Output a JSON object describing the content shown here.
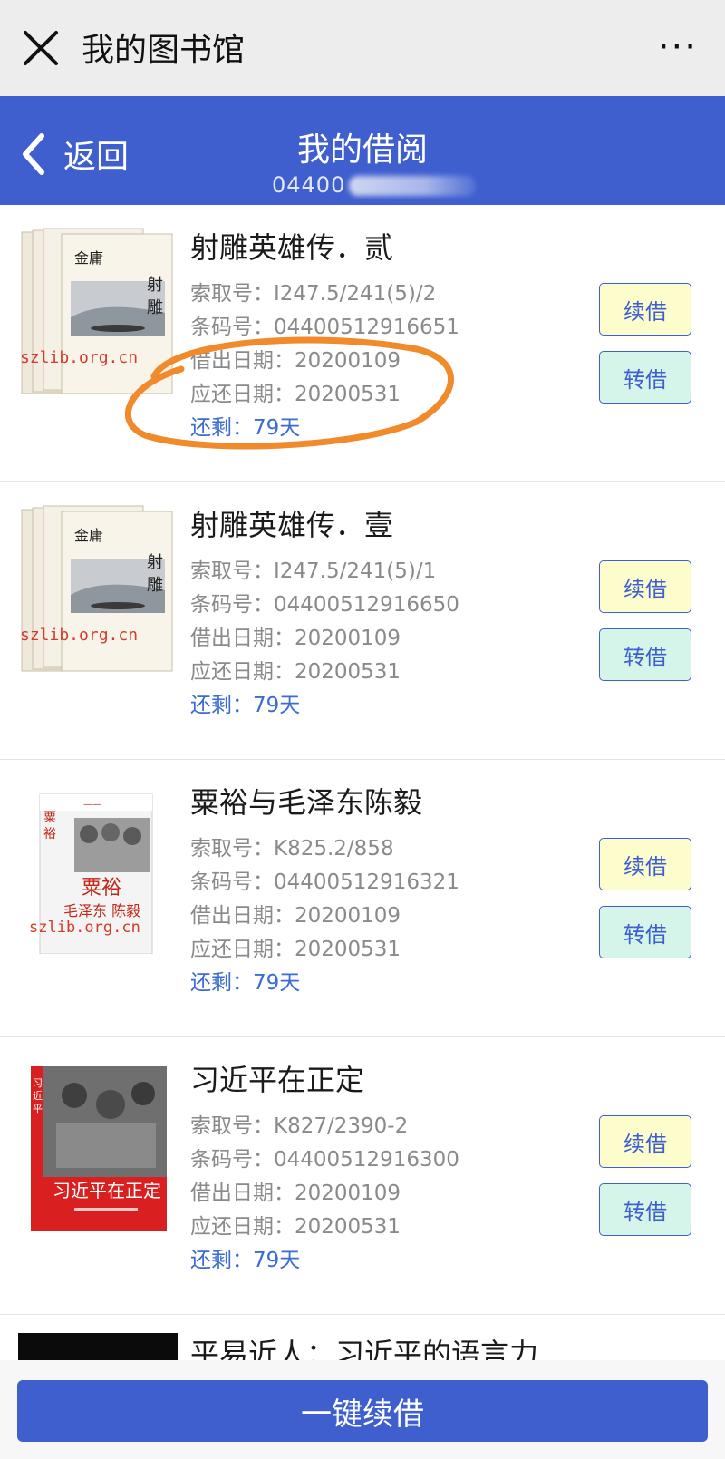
{
  "window": {
    "title": "我的图书馆",
    "close_icon": "close-icon",
    "more_icon": "more-dots-icon",
    "more_label": "···"
  },
  "header": {
    "back_label": "返回",
    "title": "我的借阅",
    "card_number_visible": "04400",
    "bg_color": "#3f5fcf"
  },
  "loans": [
    {
      "title": "射雕英雄传．贰",
      "cover_watermark": "szlib.org.cn",
      "call_no": "索取号：I247.5/241(5)/2",
      "barcode": "条码号：04400512916651",
      "borrow_date": "借出日期：20200109",
      "due_date": "应还日期：20200531",
      "remaining": "还剩：79天",
      "renew_label": "续借",
      "transfer_label": "转借"
    },
    {
      "title": "射雕英雄传．壹",
      "cover_watermark": "szlib.org.cn",
      "call_no": "索取号：I247.5/241(5)/1",
      "barcode": "条码号：04400512916650",
      "borrow_date": "借出日期：20200109",
      "due_date": "应还日期：20200531",
      "remaining": "还剩：79天",
      "renew_label": "续借",
      "transfer_label": "转借"
    },
    {
      "title": "粟裕与毛泽东陈毅",
      "cover_watermark": "szlib.org.cn",
      "call_no": "索取号：K825.2/858",
      "barcode": "条码号：04400512916321",
      "borrow_date": "借出日期：20200109",
      "due_date": "应还日期：20200531",
      "remaining": "还剩：79天",
      "renew_label": "续借",
      "transfer_label": "转借"
    },
    {
      "title": "习近平在正定",
      "cover_watermark": "",
      "call_no": "索取号：K827/2390-2",
      "barcode": "条码号：04400512916300",
      "borrow_date": "借出日期：20200109",
      "due_date": "应还日期：20200531",
      "remaining": "还剩：79天",
      "renew_label": "续借",
      "transfer_label": "转借"
    },
    {
      "title": "平易近人：习近平的语言力"
    }
  ],
  "footer": {
    "one_key_renew_label": "一键续借"
  },
  "colors": {
    "accent": "#3f5fcf",
    "renew_bg": "#fdfccd",
    "transfer_bg": "#d6f5ea",
    "remaining_text": "#3b6ccf",
    "annotation": "#f08a2a"
  }
}
